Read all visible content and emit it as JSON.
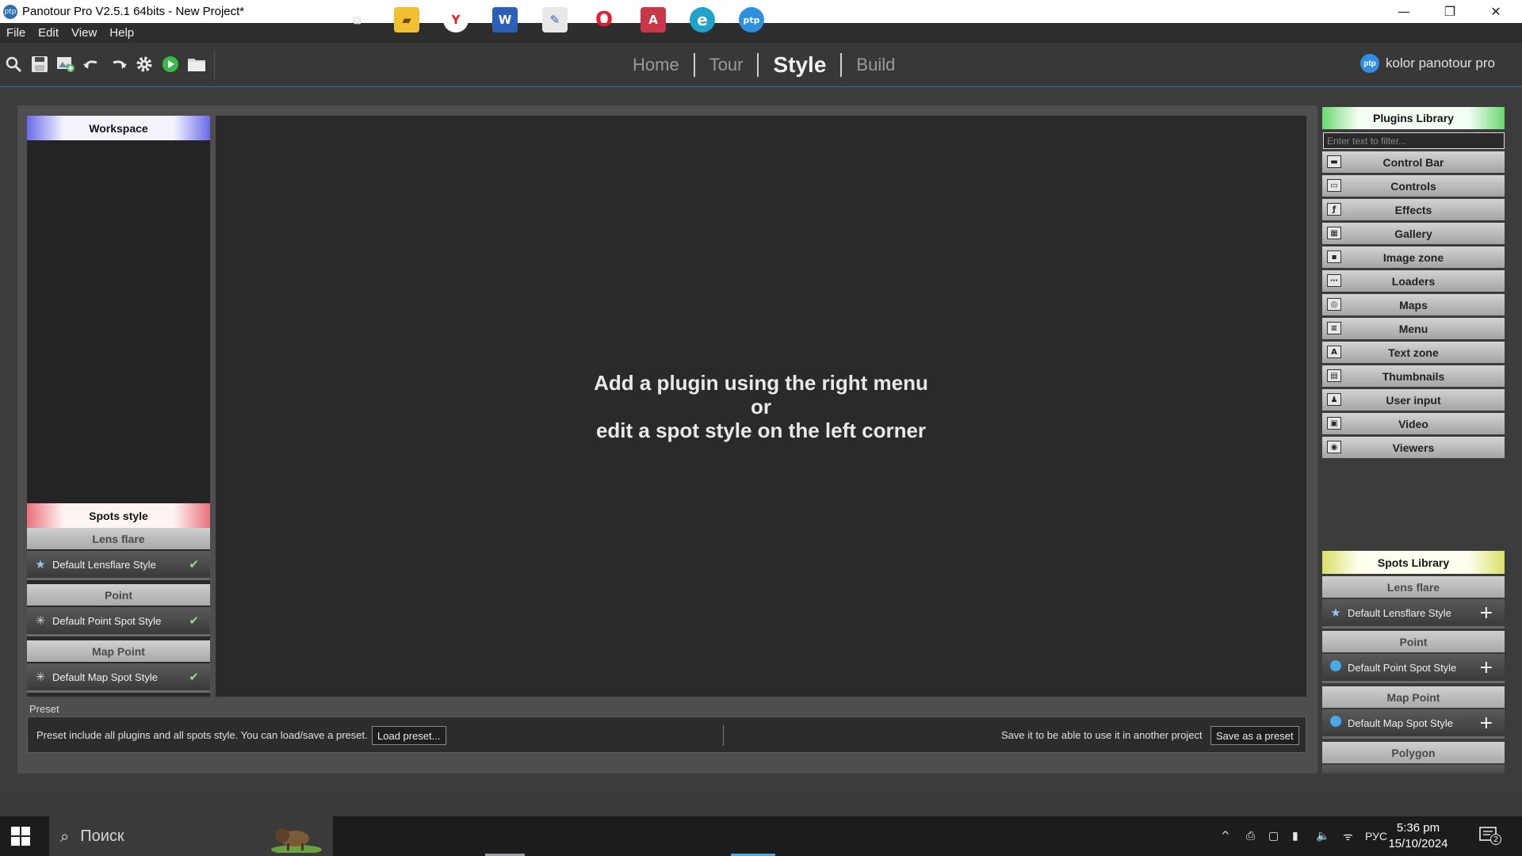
{
  "window": {
    "title": "Panotour Pro V2.5.1 64bits - New Project*",
    "app_icon": "ptp",
    "minimize_glyph": "—",
    "maximize_glyph": "❐",
    "close_glyph": "✕"
  },
  "menu": [
    "File",
    "Edit",
    "View",
    "Help"
  ],
  "toolbar": {
    "icons": [
      "open-project-icon",
      "save-icon",
      "add-panorama-icon",
      "undo-icon",
      "redo-icon",
      "settings-gear-icon",
      "play-preview-icon",
      "folder-icon"
    ],
    "nav_tabs": [
      {
        "label": "Home",
        "active": false
      },
      {
        "label": "Tour",
        "active": false
      },
      {
        "label": "Style",
        "active": true
      },
      {
        "label": "Build",
        "active": false
      }
    ],
    "brand_logo": "ptp",
    "brand_text": "kolor panotour pro"
  },
  "workspace": {
    "header": "Workspace",
    "header_color": "#6a6ae8"
  },
  "spots_style": {
    "header": "Spots style",
    "header_color": "#e8707a",
    "sections": [
      {
        "title": "Lens flare",
        "item": "Default Lensflare Style",
        "icon": "star-icon"
      },
      {
        "title": "Point",
        "item": "Default Point Spot Style",
        "icon": "sparkle-icon"
      },
      {
        "title": "Map Point",
        "item": "Default Map Spot Style",
        "icon": "sparkle-icon"
      }
    ],
    "check_glyph": "✔"
  },
  "stage_message": {
    "line1": "Add a plugin using the right menu",
    "line2": "or",
    "line3": "edit a spot style on the left corner"
  },
  "preset": {
    "title": "Preset",
    "description": "Preset include all plugins and all spots style. You can load/save a preset.",
    "load_button": "Load preset...",
    "save_hint": "Save it to be able to use it in another project",
    "save_button": "Save as a preset"
  },
  "plugins_library": {
    "header": "Plugins Library",
    "header_color": "#6ad870",
    "filter_placeholder": "Enter text to filter...",
    "items": [
      {
        "label": "Control Bar",
        "glyph": "▬"
      },
      {
        "label": "Controls",
        "glyph": "▭"
      },
      {
        "label": "Effects",
        "glyph": "ƒ"
      },
      {
        "label": "Gallery",
        "glyph": "▦"
      },
      {
        "label": "Image zone",
        "glyph": "▪"
      },
      {
        "label": "Loaders",
        "glyph": "⋯"
      },
      {
        "label": "Maps",
        "glyph": "◎"
      },
      {
        "label": "Menu",
        "glyph": "≡"
      },
      {
        "label": "Text zone",
        "glyph": "A"
      },
      {
        "label": "Thumbnails",
        "glyph": "▤"
      },
      {
        "label": "User input",
        "glyph": "♟"
      },
      {
        "label": "Video",
        "glyph": "▣"
      },
      {
        "label": "Viewers",
        "glyph": "◉"
      }
    ]
  },
  "spots_library": {
    "header": "Spots Library",
    "header_color": "#d8e06a",
    "sections": [
      {
        "title": "Lens flare",
        "item": "Default Lensflare Style",
        "icon": "star-icon"
      },
      {
        "title": "Point",
        "item": "Default Point Spot Style",
        "icon": "blue-circle-icon"
      },
      {
        "title": "Map Point",
        "item": "Default Map Spot Style",
        "icon": "blue-circle-icon"
      },
      {
        "title": "Polygon"
      }
    ],
    "plus_glyph": "+"
  },
  "taskbar": {
    "search_text": "Поиск",
    "apps": [
      {
        "name": "task-view-icon",
        "glyph": "⧉"
      },
      {
        "name": "file-explorer-icon",
        "glyph": "▰"
      },
      {
        "name": "yandex-browser-icon",
        "glyph": "Y"
      },
      {
        "name": "word-icon",
        "glyph": "W"
      },
      {
        "name": "image-viewer-icon",
        "glyph": "✎"
      },
      {
        "name": "opera-icon",
        "glyph": "O"
      },
      {
        "name": "access-icon",
        "glyph": "A"
      },
      {
        "name": "edge-icon",
        "glyph": "e"
      },
      {
        "name": "panotour-icon",
        "glyph": "ptp"
      }
    ],
    "tray_glyphs": [
      "^",
      "⎙",
      "▢",
      "▮",
      "🔈",
      "ᯤ"
    ],
    "language": "РУС",
    "time": "5:36 pm",
    "date": "15/10/2024",
    "notification_count": "2"
  }
}
